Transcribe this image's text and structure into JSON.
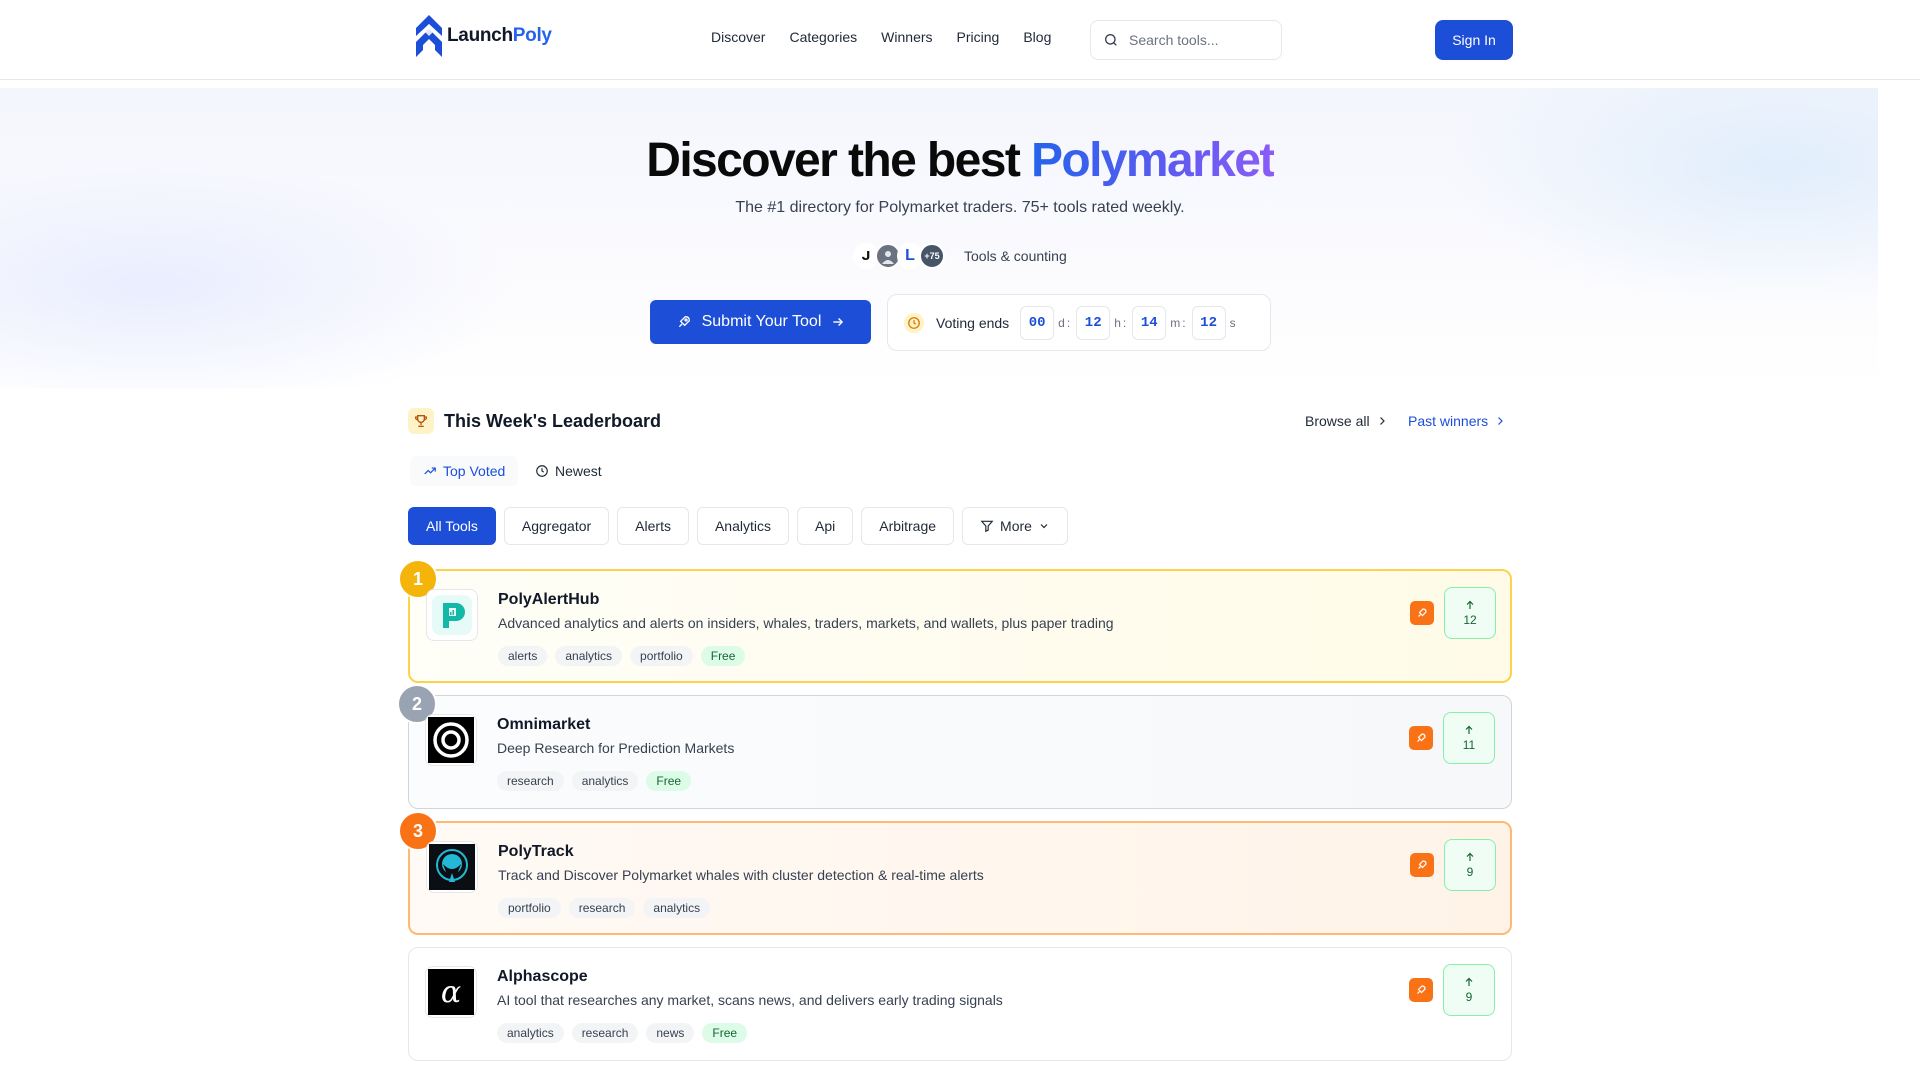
{
  "header": {
    "logo_part1": "Launch",
    "logo_part2": "Poly",
    "nav": [
      "Discover",
      "Categories",
      "Winners",
      "Pricing",
      "Blog"
    ],
    "search_placeholder": "Search tools...",
    "signin_label": "Sign In"
  },
  "hero": {
    "title_plain": "Discover the best ",
    "title_accent": "Polymarket",
    "subtitle": "The #1 directory for Polymarket traders. 75+ tools rated weekly.",
    "avatar_count_badge": "+75",
    "counting_label": "Tools & counting",
    "submit_label": "Submit Your Tool",
    "voting_label": "Voting ends",
    "countdown": {
      "days": "00",
      "days_unit": "d",
      "hours": "12",
      "hours_unit": "h",
      "minutes": "14",
      "minutes_unit": "m",
      "seconds": "12",
      "seconds_unit": "s"
    }
  },
  "leaderboard": {
    "title": "This Week's Leaderboard",
    "browse_all": "Browse all",
    "past_winners": "Past winners",
    "sort_tabs": [
      "Top Voted",
      "Newest"
    ],
    "filters": [
      "All Tools",
      "Aggregator",
      "Alerts",
      "Analytics",
      "Api",
      "Arbitrage"
    ],
    "more_label": "More",
    "items": [
      {
        "rank": "1",
        "name": "PolyAlertHub",
        "description": "Advanced analytics and alerts on insiders, whales, traders, markets, and wallets, plus paper trading",
        "tags": [
          "alerts",
          "analytics",
          "portfolio"
        ],
        "free": "Free",
        "votes": "12"
      },
      {
        "rank": "2",
        "name": "Omnimarket",
        "description": "Deep Research for Prediction Markets",
        "tags": [
          "research",
          "analytics"
        ],
        "free": "Free",
        "votes": "11"
      },
      {
        "rank": "3",
        "name": "PolyTrack",
        "description": "Track and Discover Polymarket whales with cluster detection & real-time alerts",
        "tags": [
          "portfolio",
          "research",
          "analytics"
        ],
        "free": "",
        "votes": "9"
      },
      {
        "rank": "",
        "name": "Alphascope",
        "description": "AI tool that researches any market, scans news, and delivers early trading signals",
        "tags": [
          "analytics",
          "research",
          "news"
        ],
        "free": "Free",
        "votes": "9"
      }
    ]
  },
  "colors": {
    "primary": "#1d4ed8",
    "gold": "#f5b40a",
    "silver": "#9aa3b2",
    "bronze": "#f97316",
    "vote_green": "#166534"
  },
  "icons": {
    "search": "search-icon",
    "rocket": "rocket-icon",
    "arrow_right": "arrow-right-icon",
    "clock": "clock-icon",
    "trophy": "trophy-icon",
    "chevron_right": "chevron-right-icon",
    "trending": "trending-up-icon",
    "filter": "filter-icon",
    "chevron_down": "chevron-down-icon",
    "arrow_up": "arrow-up-icon"
  }
}
